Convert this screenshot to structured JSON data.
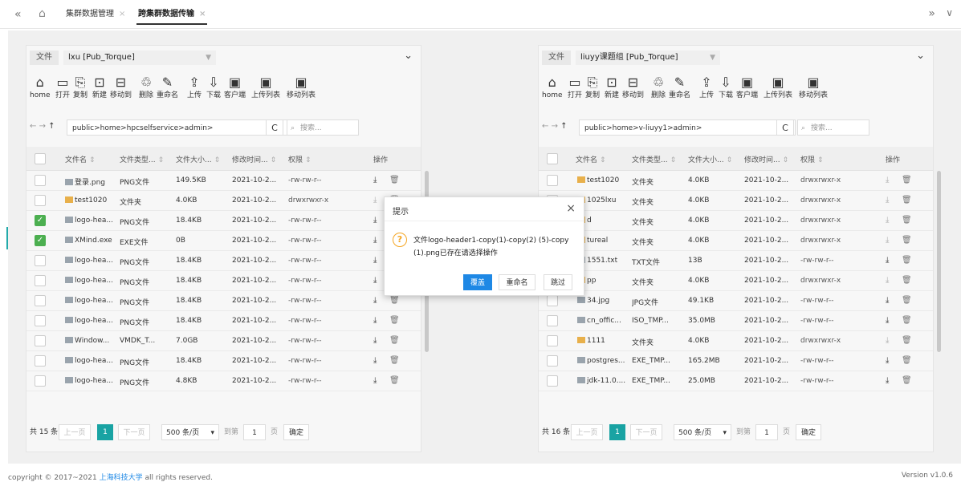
{
  "nav": {
    "collapse_icon": "«",
    "home_icon": "⌂",
    "expand_icon": "»",
    "dropdown_icon": "∨"
  },
  "tabs": [
    {
      "label": "集群数据管理",
      "close": "×",
      "active": false
    },
    {
      "label": "跨集群数据传输",
      "close": "×",
      "active": true
    }
  ],
  "toolbar_labels": [
    "home",
    "打开",
    "复制",
    "新建",
    "移动到",
    "删除",
    "重命名",
    "上传",
    "下载",
    "客户端",
    "上传列表",
    "移动列表"
  ],
  "table_headers": {
    "name": "文件名",
    "type": "文件类型...",
    "size": "文件大小...",
    "time": "修改时间...",
    "perm": "权限",
    "ops": "操作"
  },
  "left": {
    "tag": "文件",
    "cluster": "lxu [Pub_Torque]",
    "path": "public>home>hpcselfservice>admin>",
    "search_placeholder": "搜索...",
    "rows": [
      {
        "name": "登录.png",
        "type": "PNG文件",
        "size": "149.5KB",
        "time": "2021-10-2...",
        "perm": "-rw-rw-r--",
        "checked": false,
        "folder": false
      },
      {
        "name": "test1020",
        "type": "文件夹",
        "size": "4.0KB",
        "time": "2021-10-2...",
        "perm": "drwxrwxr-x",
        "checked": false,
        "folder": true
      },
      {
        "name": "logo-hea...",
        "type": "PNG文件",
        "size": "18.4KB",
        "time": "2021-10-2...",
        "perm": "-rw-rw-r--",
        "checked": true,
        "folder": false
      },
      {
        "name": "XMind.exe",
        "type": "EXE文件",
        "size": "0B",
        "time": "2021-10-2...",
        "perm": "-rw-rw-r--",
        "checked": true,
        "folder": false
      },
      {
        "name": "logo-hea...",
        "type": "PNG文件",
        "size": "18.4KB",
        "time": "2021-10-2...",
        "perm": "-rw-rw-r--",
        "checked": false,
        "folder": false
      },
      {
        "name": "logo-hea...",
        "type": "PNG文件",
        "size": "18.4KB",
        "time": "2021-10-2...",
        "perm": "-rw-rw-r--",
        "checked": false,
        "folder": false
      },
      {
        "name": "logo-hea...",
        "type": "PNG文件",
        "size": "18.4KB",
        "time": "2021-10-2...",
        "perm": "-rw-rw-r--",
        "checked": false,
        "folder": false
      },
      {
        "name": "logo-hea...",
        "type": "PNG文件",
        "size": "18.4KB",
        "time": "2021-10-2...",
        "perm": "-rw-rw-r--",
        "checked": false,
        "folder": false
      },
      {
        "name": "Window...",
        "type": "VMDK_T...",
        "size": "7.0GB",
        "time": "2021-10-2...",
        "perm": "-rw-rw-r--",
        "checked": false,
        "folder": false
      },
      {
        "name": "logo-hea...",
        "type": "PNG文件",
        "size": "18.4KB",
        "time": "2021-10-2...",
        "perm": "-rw-rw-r--",
        "checked": false,
        "folder": false
      },
      {
        "name": "logo-hea...",
        "type": "PNG文件",
        "size": "4.8KB",
        "time": "2021-10-2...",
        "perm": "-rw-rw-r--",
        "checked": false,
        "folder": false
      }
    ],
    "pager": {
      "total": "共 15 条",
      "prev": "上一页",
      "current": "1",
      "next": "下一页",
      "per_page": "500 条/页",
      "goto": "到第",
      "page_input": "1",
      "page_unit": "页",
      "confirm": "确定"
    }
  },
  "right": {
    "tag": "文件",
    "cluster": "liuyy课题组 [Pub_Torque]",
    "path": "public>home>v-liuyy1>admin>",
    "search_placeholder": "搜索...",
    "rows": [
      {
        "name": "test1020",
        "type": "文件夹",
        "size": "4.0KB",
        "time": "2021-10-2...",
        "perm": "drwxrwxr-x",
        "checked": false,
        "folder": true
      },
      {
        "name": "1025lxu",
        "type": "文件夹",
        "size": "4.0KB",
        "time": "2021-10-2...",
        "perm": "drwxrwxr-x",
        "checked": false,
        "folder": true
      },
      {
        "name": "d",
        "type": "文件夹",
        "size": "4.0KB",
        "time": "2021-10-2...",
        "perm": "drwxrwxr-x",
        "checked": false,
        "folder": true
      },
      {
        "name": "tureal",
        "type": "文件夹",
        "size": "4.0KB",
        "time": "2021-10-2...",
        "perm": "drwxrwxr-x",
        "checked": false,
        "folder": true
      },
      {
        "name": "1551.txt",
        "type": "TXT文件",
        "size": "13B",
        "time": "2021-10-2...",
        "perm": "-rw-rw-r--",
        "checked": false,
        "folder": false
      },
      {
        "name": "pp",
        "type": "文件夹",
        "size": "4.0KB",
        "time": "2021-10-2...",
        "perm": "drwxrwxr-x",
        "checked": false,
        "folder": true
      },
      {
        "name": "34.jpg",
        "type": "JPG文件",
        "size": "49.1KB",
        "time": "2021-10-2...",
        "perm": "-rw-rw-r--",
        "checked": false,
        "folder": false
      },
      {
        "name": "cn_offic...",
        "type": "ISO_TMP...",
        "size": "35.0MB",
        "time": "2021-10-2...",
        "perm": "-rw-rw-r--",
        "checked": false,
        "folder": false
      },
      {
        "name": "1111",
        "type": "文件夹",
        "size": "4.0KB",
        "time": "2021-10-2...",
        "perm": "drwxrwxr-x",
        "checked": false,
        "folder": true
      },
      {
        "name": "postgres...",
        "type": "EXE_TMP...",
        "size": "165.2MB",
        "time": "2021-10-2...",
        "perm": "-rw-rw-r--",
        "checked": false,
        "folder": false
      },
      {
        "name": "jdk-11.0....",
        "type": "EXE_TMP...",
        "size": "25.0MB",
        "time": "2021-10-2...",
        "perm": "-rw-rw-r--",
        "checked": false,
        "folder": false
      }
    ],
    "pager": {
      "total": "共 16 条",
      "prev": "上一页",
      "current": "1",
      "next": "下一页",
      "per_page": "500 条/页",
      "goto": "到第",
      "page_input": "1",
      "page_unit": "页",
      "confirm": "确定"
    }
  },
  "dialog": {
    "title": "提示",
    "close": "×",
    "icon": "?",
    "message": "文件logo-header1-copy(1)-copy(2) (5)-copy (1).png已存在请选择操作",
    "buttons": {
      "overwrite": "覆盖",
      "rename": "重命名",
      "skip": "跳过"
    }
  },
  "footer": {
    "copyright_prefix": "copyright © 2017~2021 ",
    "org": "上海科技大学",
    "copyright_suffix": " all rights reserved.",
    "version": "Version v1.0.6"
  },
  "colors": {
    "accent": "#19a3a3",
    "primary_button": "#1e88e5",
    "checked": "#4caf50",
    "warning": "#f5a623"
  }
}
